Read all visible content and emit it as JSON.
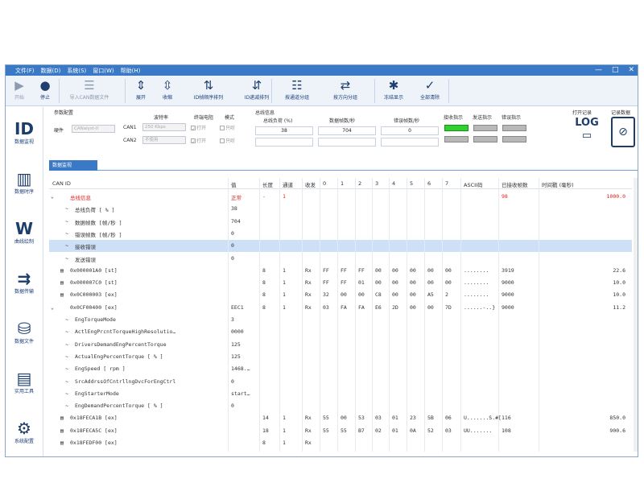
{
  "window": {
    "menus": [
      "文件(F)",
      "数据(D)",
      "系统(S)",
      "窗口(W)",
      "帮助(H)"
    ],
    "controls": [
      "—",
      "□",
      "✕"
    ]
  },
  "toolbar": [
    {
      "label": "开始",
      "icon": "play-icon",
      "disabled": true
    },
    {
      "label": "停止",
      "icon": "stop-icon",
      "disabled": false
    },
    {
      "label": "导入CAN数据文件",
      "icon": "database-icon",
      "disabled": true
    },
    {
      "label": "展开",
      "icon": "expand-icon",
      "disabled": false
    },
    {
      "label": "收缩",
      "icon": "collapse-icon",
      "disabled": false
    },
    {
      "label": "ID帧顺序排列",
      "icon": "sort-asc-icon",
      "disabled": false
    },
    {
      "label": "ID递减排列",
      "icon": "sort-desc-icon",
      "disabled": false
    },
    {
      "label": "按通道分组",
      "icon": "channel-icon",
      "disabled": false
    },
    {
      "label": "按方向分组",
      "icon": "direction-icon",
      "disabled": false
    },
    {
      "label": "冻结显示",
      "icon": "freeze-icon",
      "disabled": false
    },
    {
      "label": "全部清除",
      "icon": "clear-icon",
      "disabled": false
    }
  ],
  "nav": [
    {
      "label": "数据监视",
      "icon": "id-icon"
    },
    {
      "label": "数据时序",
      "icon": "timing-icon"
    },
    {
      "label": "曲线绘制",
      "icon": "curve-icon"
    },
    {
      "label": "数据传输",
      "icon": "transfer-icon"
    },
    {
      "label": "数据文件",
      "icon": "file-icon"
    },
    {
      "label": "实用工具",
      "icon": "tools-icon"
    },
    {
      "label": "系统配置",
      "icon": "gear-icon"
    }
  ],
  "config": {
    "title": "参数配置",
    "hardware": "硬件",
    "hardware_value": "CANalyst-II",
    "baud_label": "波特率",
    "term_label": "终端电阻",
    "mode_label": "模式",
    "can1": "CAN1",
    "can2": "CAN2",
    "can1_baud": "250 Kbps",
    "can2_baud": "不使用",
    "open": "打开",
    "listen": "只听"
  },
  "busstat": {
    "title": "总线信息",
    "load_label": "总线负荷 (%)",
    "rate_label": "数据帧数/秒",
    "err_label": "错误帧数/秒",
    "load": "38",
    "rate": "704",
    "err": "0"
  },
  "indicators": {
    "rx": "接收指示",
    "tx": "发送指示",
    "err": "错误指示"
  },
  "logs": {
    "open_label": "打开记录",
    "rec_label": "记录数据"
  },
  "tab": "数据监视",
  "columns": [
    "CAN ID",
    "值",
    "长度",
    "通道",
    "收发",
    "0",
    "1",
    "2",
    "3",
    "4",
    "5",
    "6",
    "7",
    "ASCII码",
    "已接收帧数",
    "时间戳 (毫秒)"
  ],
  "rows": [
    {
      "expander": "⌄",
      "id": "总线信息",
      "value": "正常",
      "len": "-",
      "ch": "1",
      "cnt": "98",
      "ts": "1000.0",
      "red": true,
      "indent": 0
    },
    {
      "expander": "~",
      "id": "总线负荷  [ % ]",
      "value": "38",
      "indent": 1
    },
    {
      "expander": "~",
      "id": "数据帧数  [帧/秒 ]",
      "value": "704",
      "indent": 1
    },
    {
      "expander": "~",
      "id": "错误帧数  [帧/秒 ]",
      "value": "0",
      "indent": 1
    },
    {
      "expander": "~",
      "id": "接收错误",
      "value": "0",
      "indent": 1,
      "sel": true
    },
    {
      "expander": "~",
      "id": "发送错误",
      "value": "0",
      "indent": 1
    },
    {
      "expander": "",
      "id": "0x000001A0 [st]",
      "len": "8",
      "ch": "1",
      "dir": "Rx",
      "d": [
        "FF",
        "FF",
        "FF",
        "00",
        "00",
        "00",
        "00",
        "00"
      ],
      "ascii": "........",
      "cnt": "3919",
      "ts": "22.6",
      "indent": 0
    },
    {
      "expander": "",
      "id": "0x000007C0 [st]",
      "len": "8",
      "ch": "1",
      "dir": "Rx",
      "d": [
        "FF",
        "FF",
        "01",
        "00",
        "00",
        "00",
        "00",
        "00"
      ],
      "ascii": "........",
      "cnt": "9000",
      "ts": "10.0",
      "indent": 0
    },
    {
      "expander": "",
      "id": "0x0C000003 [ex]",
      "len": "8",
      "ch": "1",
      "dir": "Rx",
      "d": [
        "32",
        "00",
        "00",
        "C8",
        "00",
        "00",
        "A5",
        "2"
      ],
      "ascii": "........",
      "cnt": "9000",
      "ts": "10.0",
      "indent": 0
    },
    {
      "expander": "⌄",
      "id": "0x0CF00400 [ex]",
      "value": "EEC1",
      "len": "8",
      "ch": "1",
      "dir": "Rx",
      "d": [
        "03",
        "FA",
        "FA",
        "E6",
        "2D",
        "00",
        "00",
        "7D"
      ],
      "ascii": "......-..}",
      "cnt": "9000",
      "ts": "11.2",
      "indent": 0
    },
    {
      "expander": "~",
      "id": "EngTorqueMode",
      "value": "3",
      "indent": 1
    },
    {
      "expander": "~",
      "id": "ActlEngPrcntTorqueHighResolutio…",
      "value": "0000",
      "indent": 1
    },
    {
      "expander": "~",
      "id": "DriversDemandEngPercentTorque",
      "value": "125",
      "indent": 1
    },
    {
      "expander": "~",
      "id": "ActualEngPercentTorque  [ % ]",
      "value": "125",
      "indent": 1
    },
    {
      "expander": "~",
      "id": "EngSpeed  [ rpm ]",
      "value": "1468.…",
      "indent": 1
    },
    {
      "expander": "~",
      "id": "SrcAddrssOfCntrllngDvcForEngCtrl",
      "value": "0",
      "indent": 1
    },
    {
      "expander": "~",
      "id": "EngStarterMode",
      "value": "start…",
      "indent": 1
    },
    {
      "expander": "~",
      "id": "EngDemandPercentTorque  [ % ]",
      "value": "0",
      "indent": 1
    },
    {
      "expander": "",
      "id": "0x18FECA1B [ex]",
      "len": "14",
      "ch": "1",
      "dir": "Rx",
      "d": [
        "55",
        "00",
        "53",
        "03",
        "01",
        "23",
        "5B",
        "06"
      ],
      "ascii": "U.......S.#[",
      "cnt": "116",
      "ts": "850.0",
      "indent": 0
    },
    {
      "expander": "",
      "id": "0x18FECA5C [ex]",
      "len": "18",
      "ch": "1",
      "dir": "Rx",
      "d": [
        "55",
        "55",
        "B7",
        "02",
        "01",
        "0A",
        "52",
        "03"
      ],
      "ascii": "UU.......",
      "cnt": "108",
      "ts": "900.6",
      "indent": 0
    },
    {
      "expander": "",
      "id": "0x18FEDF00 [ex]",
      "len": "8",
      "ch": "1",
      "dir": "Rx",
      "d": [
        "",
        "",
        "",
        "",
        "",
        "",
        "",
        ""
      ],
      "ascii": "",
      "cnt": "",
      "ts": "",
      "indent": 0
    }
  ]
}
